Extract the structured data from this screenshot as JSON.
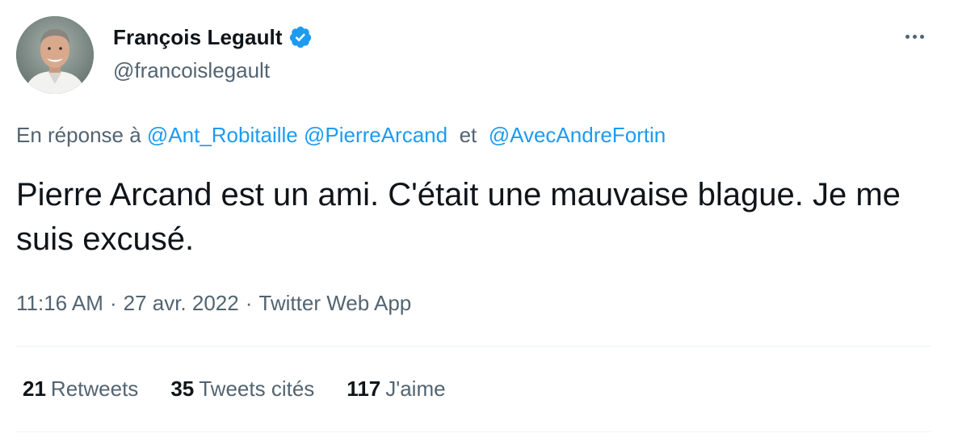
{
  "author": {
    "display_name": "François Legault",
    "handle": "@francoislegault",
    "verified": true,
    "verified_color": "#1d9bf0"
  },
  "reply_to": {
    "prefix": "En réponse à",
    "users": [
      "@Ant_Robitaille",
      "@PierreArcand",
      "@AvecAndreFortin"
    ],
    "conjunction": "et"
  },
  "tweet": {
    "text": "Pierre Arcand est un ami. C'était une mauvaise blague. Je me suis excusé.",
    "time": "11:16 AM",
    "date": "27 avr. 2022",
    "source": "Twitter Web App",
    "separator": "·"
  },
  "stats": [
    {
      "count": "21",
      "label": "Retweets"
    },
    {
      "count": "35",
      "label": "Tweets cités"
    },
    {
      "count": "117",
      "label": "J'aime"
    }
  ],
  "icons": {
    "more": "more-options-icon",
    "verified": "verified-badge-icon"
  },
  "colors": {
    "link": "#1d9bf0",
    "secondary_text": "#536471",
    "primary_text": "#0f1419"
  }
}
